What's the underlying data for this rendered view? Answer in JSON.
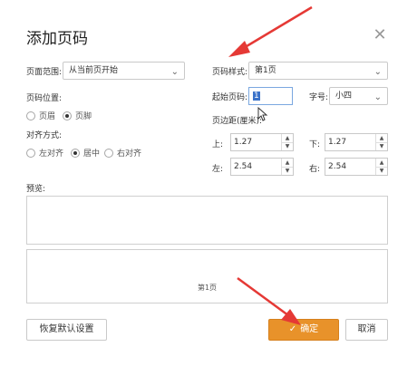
{
  "dialog": {
    "title": "添加页码",
    "close_icon": "close-icon"
  },
  "range": {
    "label": "页面范围:",
    "value": "从当前页开始"
  },
  "position": {
    "label": "页码位置:",
    "options": [
      {
        "label": "页眉",
        "checked": false
      },
      {
        "label": "页脚",
        "checked": true
      }
    ]
  },
  "align": {
    "label": "对齐方式:",
    "options": [
      {
        "label": "左对齐",
        "checked": false
      },
      {
        "label": "居中",
        "checked": true
      },
      {
        "label": "右对齐",
        "checked": false
      }
    ]
  },
  "style": {
    "label": "页码样式:",
    "value": "第1页"
  },
  "start": {
    "label": "起始页码:",
    "value": "1"
  },
  "font_size": {
    "label": "字号:",
    "value": "小四"
  },
  "margins": {
    "label": "页边距(厘米):",
    "top_label": "上:",
    "top_value": "1.27",
    "bottom_label": "下:",
    "bottom_value": "1.27",
    "left_label": "左:",
    "left_value": "2.54",
    "right_label": "右:",
    "right_value": "2.54"
  },
  "preview": {
    "label": "预览:",
    "page_text": "第1页"
  },
  "buttons": {
    "reset": "恢复默认设置",
    "ok": "确定",
    "cancel": "取消"
  },
  "colors": {
    "primary": "#e8922a",
    "arrow": "#e53935"
  }
}
